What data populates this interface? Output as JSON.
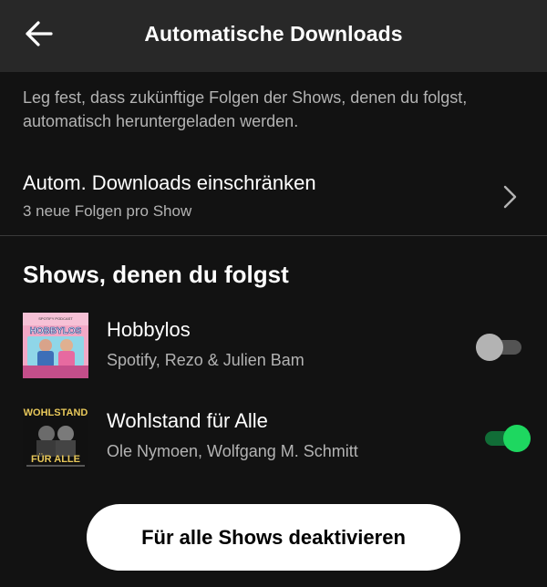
{
  "header": {
    "title": "Automatische Downloads"
  },
  "description": "Leg fest, dass zukünftige Folgen der Shows, denen du folgst, automatisch heruntergeladen werden.",
  "limit": {
    "title": "Autom. Downloads einschränken",
    "subtitle": "3 neue Folgen pro Show"
  },
  "section_title": "Shows, denen du folgst",
  "shows": [
    {
      "name": "Hobbylos",
      "artist": "Spotify, Rezo & Julien Bam",
      "enabled": false,
      "cover_text": "HOBBYLOS",
      "cover_caption": "SPOTIFY PODCAST"
    },
    {
      "name": "Wohlstand für Alle",
      "artist": "Ole Nymoen, Wolfgang M. Schmitt",
      "enabled": true,
      "cover_text_top": "WOHLSTAND",
      "cover_text_bottom": "FÜR ALLE"
    }
  ],
  "footer": {
    "button_label": "Für alle Shows deaktivieren"
  },
  "colors": {
    "background": "#121212",
    "header": "#282828",
    "secondary_text": "#b3b3b3",
    "accent_green": "#1ed760",
    "button": "#ffffff"
  }
}
